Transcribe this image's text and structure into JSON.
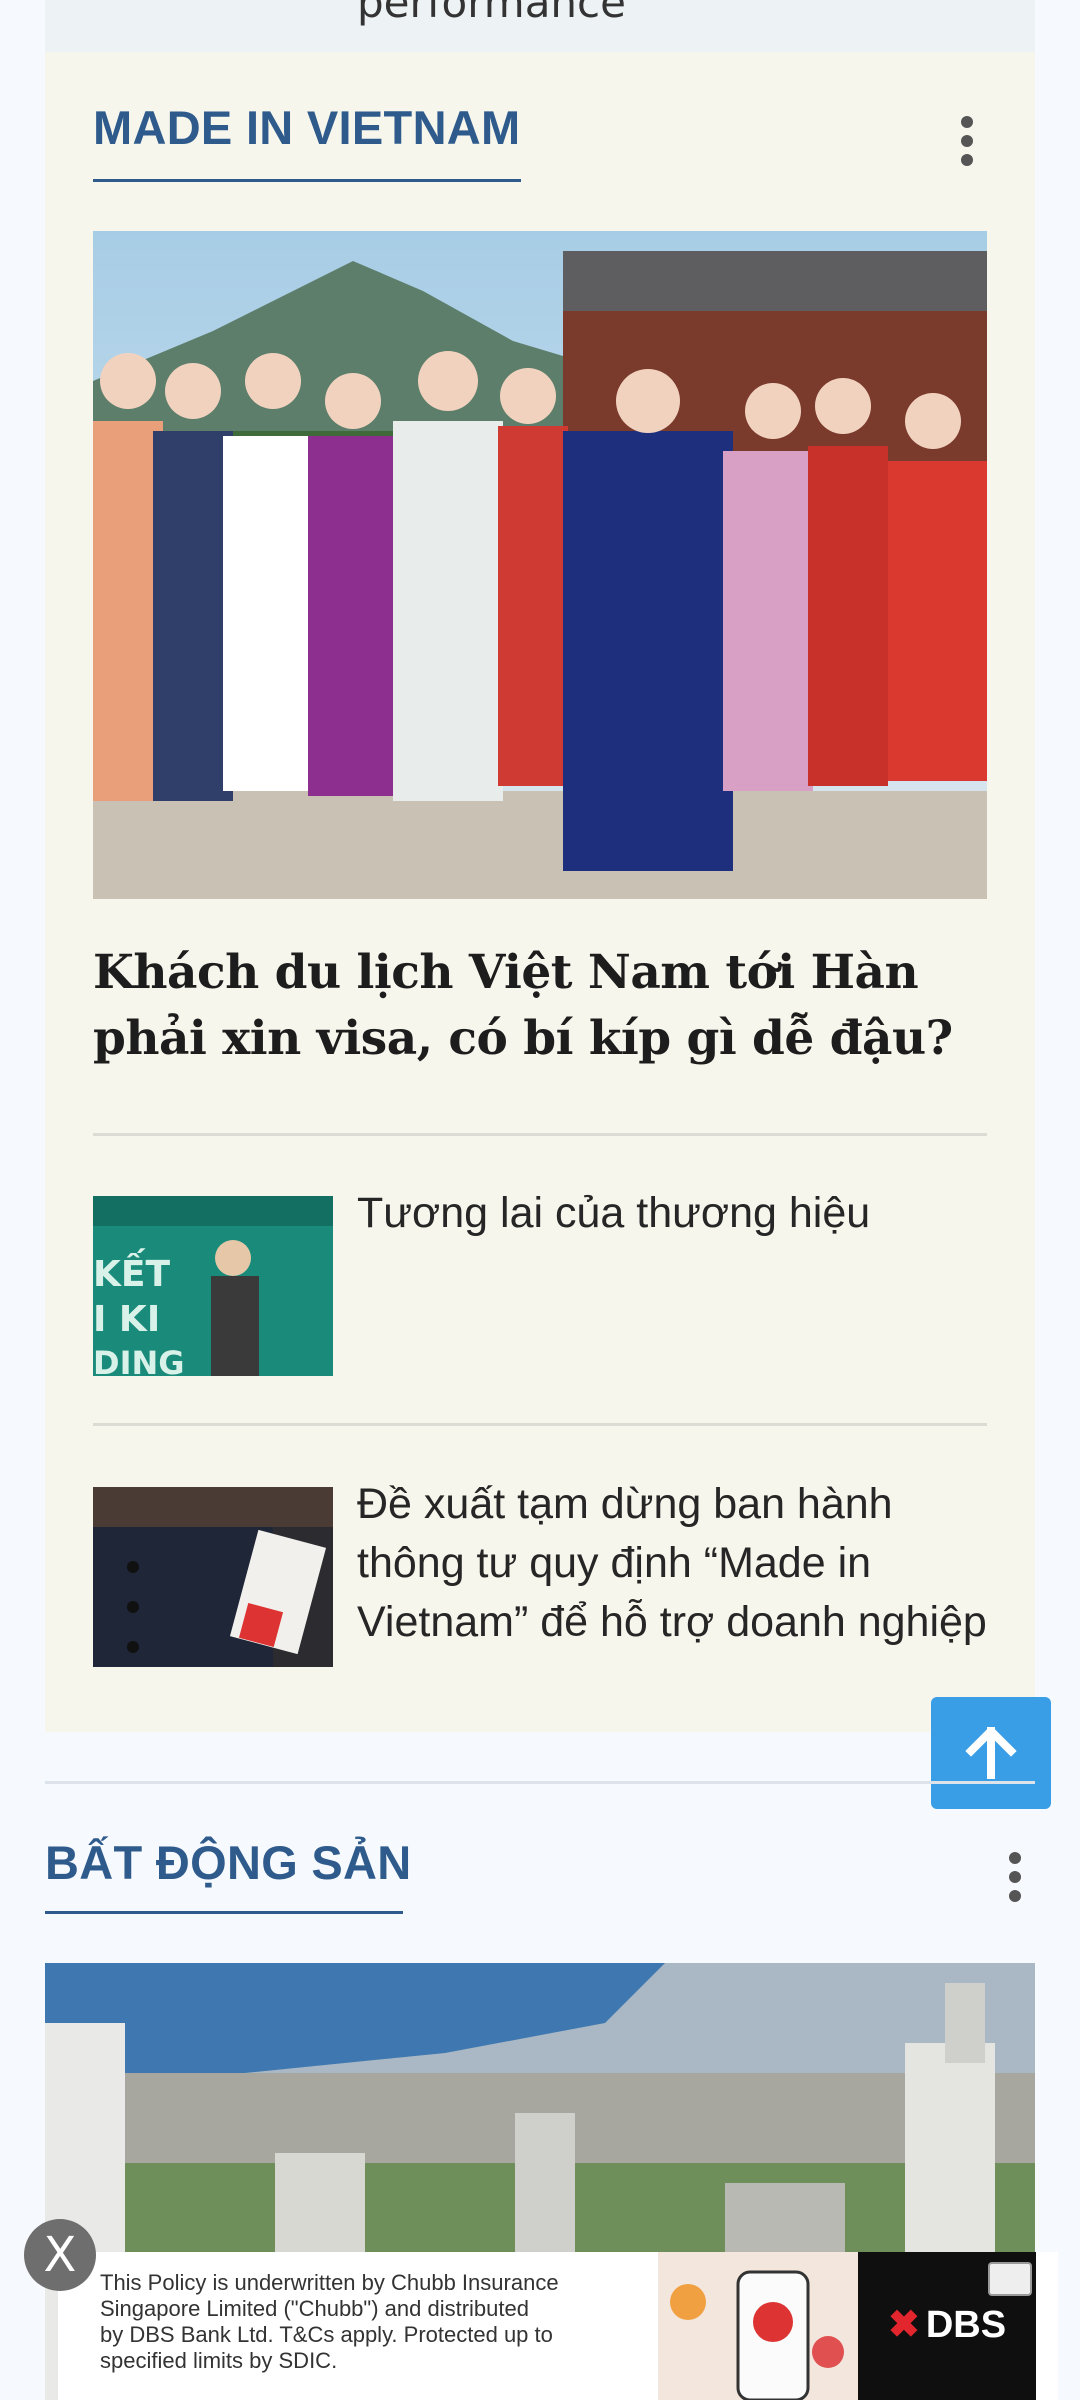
{
  "previous_item": {
    "title_fragment": "performance"
  },
  "made_in_vietnam": {
    "section_title": "MADE IN VIETNAM",
    "menu_icon": "kebab-menu-icon",
    "featured": {
      "image_desc": "hanbok-tourists-photo",
      "headline": "Khách du lịch Việt Nam tới Hàn phải xin visa, có bí kíp gì dễ đậu?"
    },
    "items": [
      {
        "title": "Tương lai của thương hiệu",
        "thumb": "speaker-stage-photo"
      },
      {
        "title": "Đề xuất tạm dừng ban hành thông tư quy định “Made in Vietnam” để hỗ trợ doanh nghiệp",
        "thumb": "garment-tag-photo"
      }
    ]
  },
  "scroll_top": {
    "icon": "arrow-up-icon"
  },
  "bat_dong_san": {
    "section_title": "BẤT ĐỘNG SẢN",
    "menu_icon": "kebab-menu-icon",
    "featured": {
      "image_desc": "city-aerial-photo"
    }
  },
  "ad": {
    "lines": [
      "This Policy is underwritten by Chubb Insurance",
      "Singapore Limited (\"Chubb\") and distributed",
      "by DBS Bank Ltd. T&Cs apply. Protected up to",
      "specified limits by SDIC."
    ],
    "brand": "DBS",
    "close_label": "X"
  },
  "colors": {
    "accent": "#2f5b8c",
    "card_bg": "#f7f6ec",
    "scroll_button": "#3a9ee6"
  }
}
